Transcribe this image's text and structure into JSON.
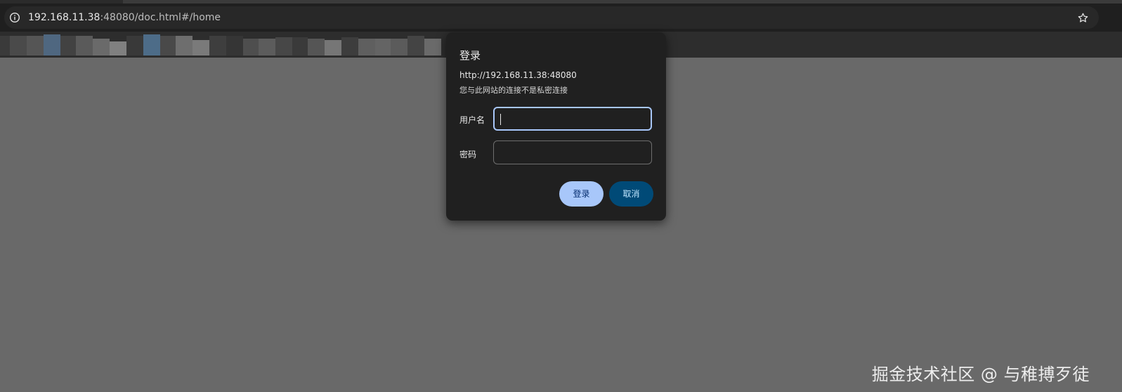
{
  "browser": {
    "url_host": "192.168.11.38",
    "url_rest": ":48080/doc.html#/home",
    "info_icon": "info-icon",
    "bookmark_icon": "star-icon"
  },
  "dialog": {
    "title": "登录",
    "origin": "http://192.168.11.38:48080",
    "warning": "您与此网站的连接不是私密连接",
    "username_label": "用户名",
    "username_value": "",
    "password_label": "密码",
    "password_value": "",
    "login_label": "登录",
    "cancel_label": "取消"
  },
  "watermark": "掘金技术社区 @ 与稚搏歹徒",
  "colors": {
    "background": "#696969",
    "dialog": "#202020",
    "focus_ring": "#a8c7fa",
    "login_button": "#a8c7fa",
    "cancel_button": "#004a77"
  }
}
